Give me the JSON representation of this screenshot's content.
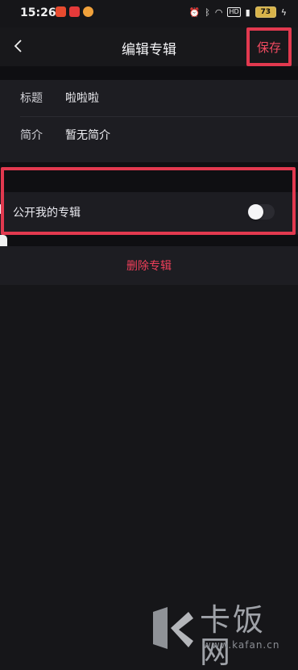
{
  "status": {
    "time": "15:26",
    "hd_label": "HD",
    "battery": "73",
    "app_icons": [
      "app-icon-1",
      "app-icon-2",
      "app-icon-3"
    ]
  },
  "nav": {
    "title": "编辑专辑",
    "back_icon": "chevron-left-icon",
    "save_label": "保存"
  },
  "form": {
    "rows": [
      {
        "label": "标题",
        "value": "啦啦啦"
      },
      {
        "label": "简介",
        "value": "暂无简介"
      }
    ]
  },
  "public_section": {
    "label": "公开我的专辑",
    "enabled": false
  },
  "delete_label": "删除专辑",
  "watermark": {
    "name": "卡饭网",
    "url": "www.kafan.cn"
  },
  "colors": {
    "accent": "#ef3f5a",
    "highlight": "#e2394f",
    "background": "#161619"
  }
}
